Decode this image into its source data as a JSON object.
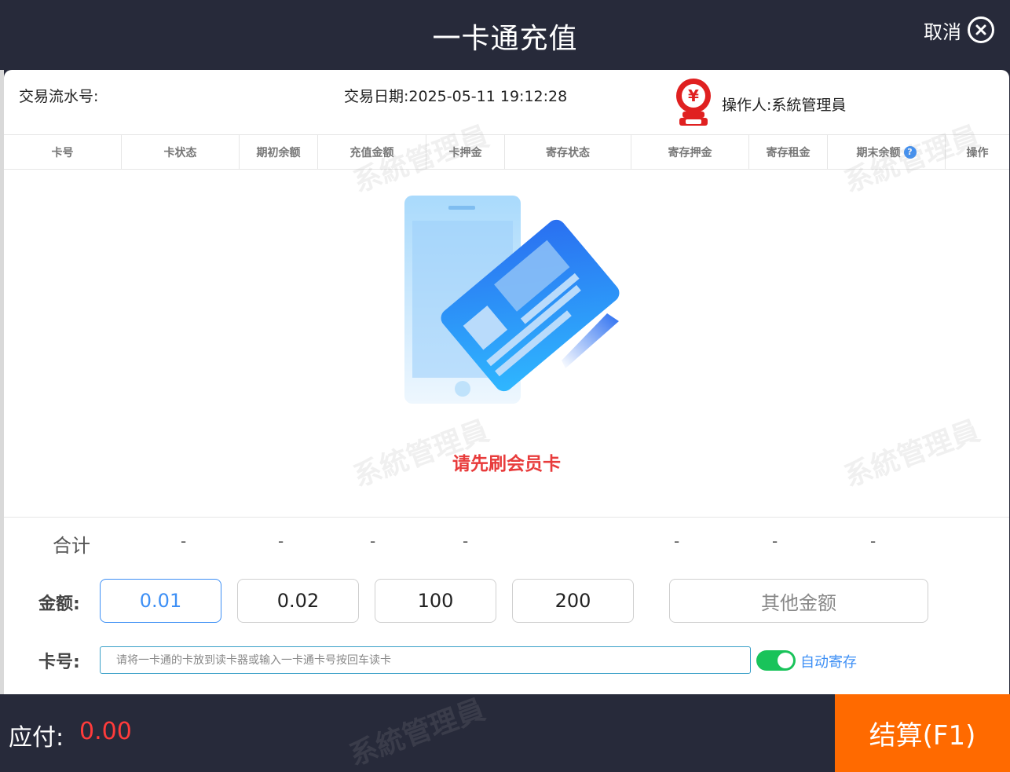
{
  "header": {
    "title": "一卡通充值",
    "cancel_label": "取消"
  },
  "info": {
    "serial_label": "交易流水号:",
    "date_text": "交易日期:2025-05-11 19:12:28",
    "operator_text": "操作人:系統管理員"
  },
  "table": {
    "columns": [
      "卡号",
      "卡状态",
      "期初余额",
      "充值金额",
      "卡押金",
      "寄存状态",
      "寄存押金",
      "寄存租金",
      "期末余额",
      "操作"
    ],
    "help_mark": "?"
  },
  "empty_state": {
    "message": "请先刷会员卡"
  },
  "watermark_text": "系統管理員",
  "summary": {
    "label": "合计",
    "values": [
      "-",
      "-",
      "-",
      "-",
      "-",
      "-",
      "-"
    ]
  },
  "amount": {
    "label": "金额:",
    "options": [
      "0.01",
      "0.02",
      "100",
      "200"
    ],
    "other_label": "其他金额",
    "selected": "0.01"
  },
  "card": {
    "label": "卡号:",
    "placeholder": "请将一卡通的卡放到读卡器或输入一卡通卡号按回车读卡",
    "auto_store_label": "自动寄存",
    "auto_store_on": true
  },
  "footer": {
    "pay_label": "应付:",
    "pay_value": "0.00",
    "settle_label": "结算(F1)"
  },
  "colors": {
    "dark_bg": "#272a3a",
    "accent_blue": "#3d8ff5",
    "alert_red": "#e83b3b",
    "settle_orange": "#ff6a00",
    "toggle_green": "#19c35a"
  }
}
